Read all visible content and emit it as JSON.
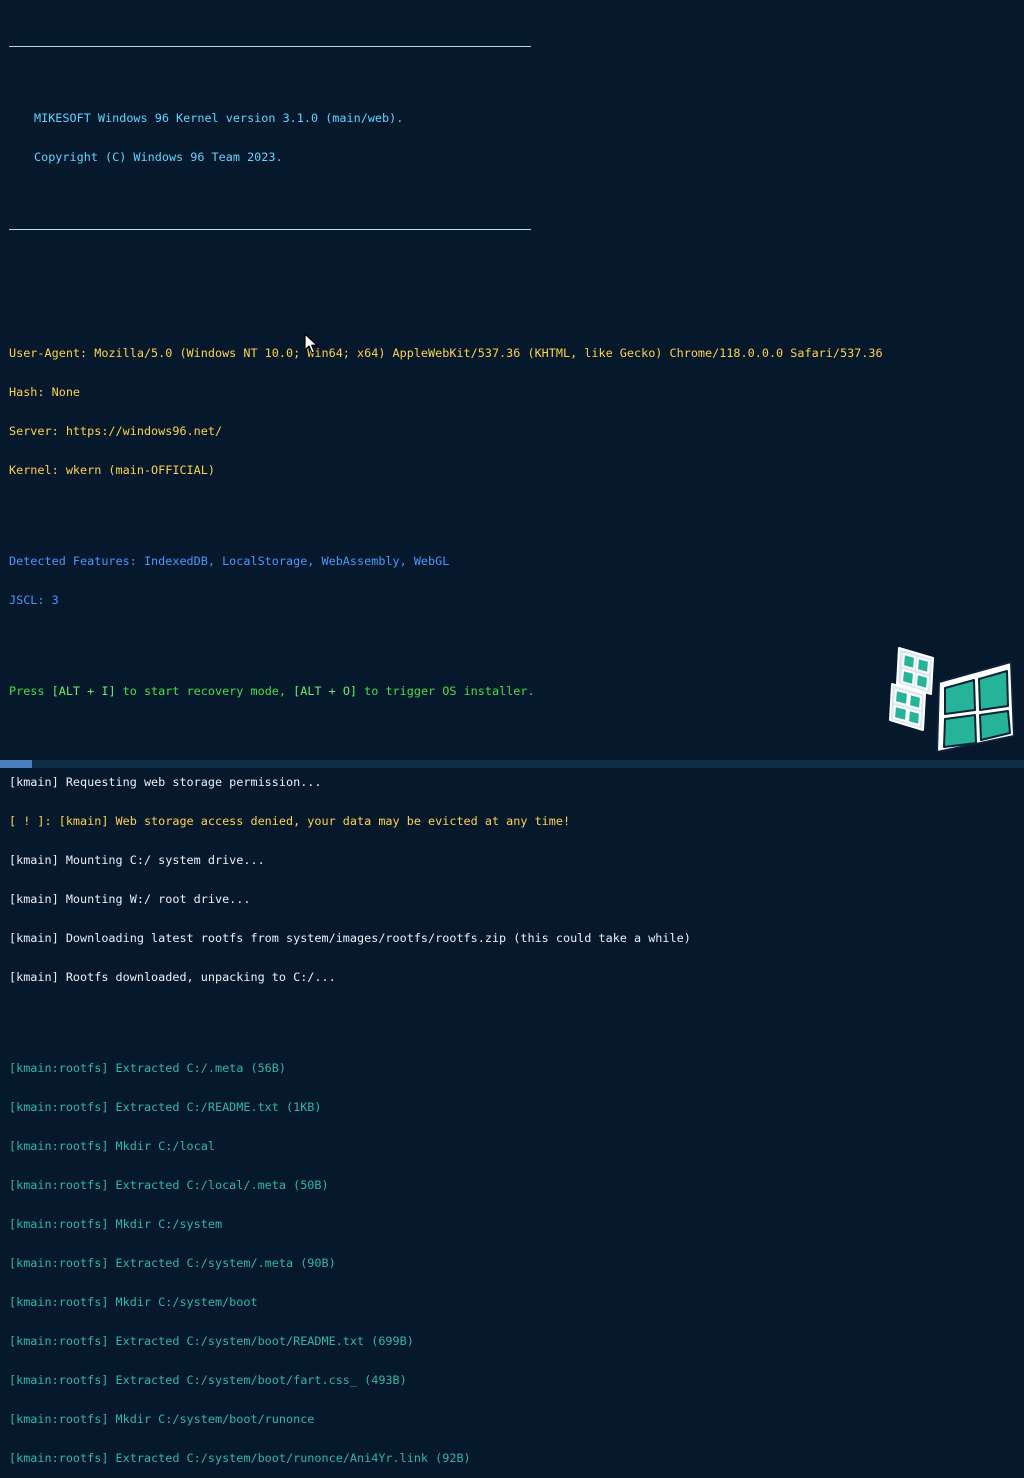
{
  "banner": {
    "line1": "MIKESOFT Windows 96 Kernel version 3.1.0 (main/web).",
    "line2": "Copyright (C) Windows 96 Team 2023."
  },
  "system_info": {
    "user_agent": "User-Agent: Mozilla/5.0 (Windows NT 10.0; Win64; x64) AppleWebKit/537.36 (KHTML, like Gecko) Chrome/118.0.0.0 Safari/537.36",
    "hash": "Hash: None",
    "server": "Server: https://windows96.net/",
    "kernel": "Kernel: wkern (main-OFFICIAL)"
  },
  "features": {
    "detected": "Detected Features: IndexedDB, LocalStorage, WebAssembly, WebGL",
    "jscl": "JSCL: 3"
  },
  "recovery": {
    "prefix": "Press ",
    "key1": "[ALT + I]",
    "middle": " to start recovery mode, ",
    "key2": "[ALT + O]",
    "suffix": " to trigger OS installer."
  },
  "kmain_log": [
    {
      "text": "[kmain] Requesting web storage permission...",
      "color": "white"
    },
    {
      "text": "[ ! ]: [kmain] Web storage access denied, your data may be evicted at any time!",
      "color": "yellow"
    },
    {
      "text": "[kmain] Mounting C:/ system drive...",
      "color": "white"
    },
    {
      "text": "[kmain] Mounting W:/ root drive...",
      "color": "white"
    },
    {
      "text": "[kmain] Downloading latest rootfs from system/images/rootfs/rootfs.zip (this could take a while)",
      "color": "white"
    },
    {
      "text": "[kmain] Rootfs downloaded, unpacking to C:/...",
      "color": "white"
    }
  ],
  "rootfs_log": [
    "[kmain:rootfs] Extracted C:/.meta (56B)",
    "[kmain:rootfs] Extracted C:/README.txt (1KB)",
    "[kmain:rootfs] Mkdir C:/local",
    "[kmain:rootfs] Extracted C:/local/.meta (50B)",
    "[kmain:rootfs] Mkdir C:/system",
    "[kmain:rootfs] Extracted C:/system/.meta (90B)",
    "[kmain:rootfs] Mkdir C:/system/boot",
    "[kmain:rootfs] Extracted C:/system/boot/README.txt (699B)",
    "[kmain:rootfs] Extracted C:/system/boot/fart.css_ (493B)",
    "[kmain:rootfs] Mkdir C:/system/boot/runonce",
    "[kmain:rootfs] Extracted C:/system/boot/runonce/Ani4Yr.link (92B)"
  ],
  "icons": {
    "cursor": "mouse-pointer-icon",
    "logo": "windows-96-logo-icon"
  },
  "colors": {
    "background": "#05182c",
    "banner": "#5ed6ff",
    "system_info": "#ffd24a",
    "features": "#4a98ff",
    "recovery": "#45df4a",
    "log": "#eaf1f8",
    "rootfs": "#30b7a7",
    "logo_accent": "#25b497"
  }
}
